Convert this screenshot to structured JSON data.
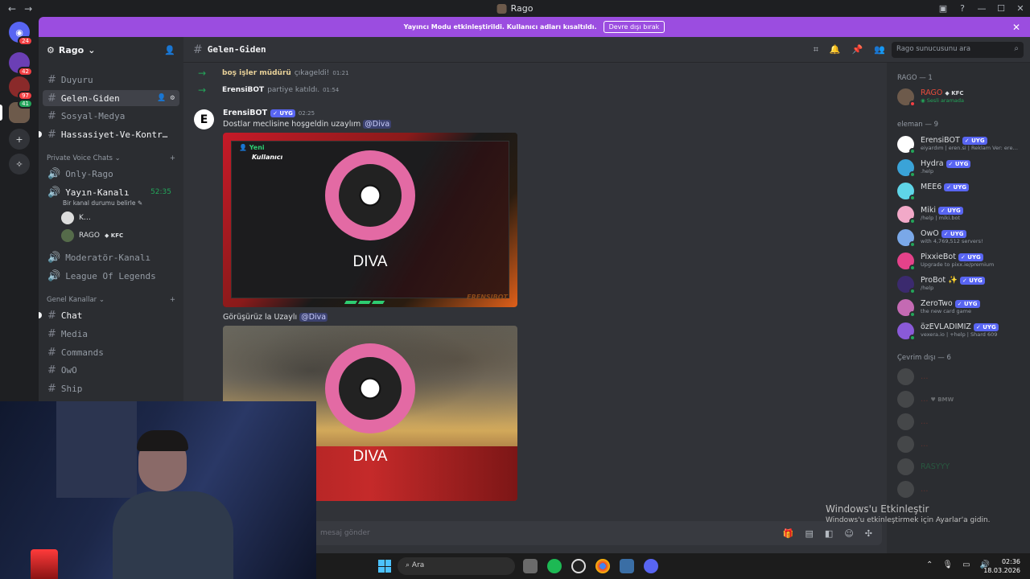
{
  "window": {
    "title": "Rago"
  },
  "banner": {
    "text": "Yayıncı Modu etkinleştirildi. Kullanıcı adları kısaltıldı.",
    "button": "Devre dışı bırak"
  },
  "rail": {
    "badges": [
      "24",
      "42",
      "97",
      "41"
    ]
  },
  "server": {
    "name": "Rago"
  },
  "channels": [
    {
      "name": "Duyuru"
    },
    {
      "name": "Gelen-Giden"
    },
    {
      "name": "Sosyal-Medya"
    },
    {
      "name": "Hassasiyet-Ve-Kontr…"
    }
  ],
  "private_voice": {
    "category": "Private Voice Chats",
    "channels": [
      {
        "name": "Only-Rago"
      },
      {
        "name": "Yayın-Kanalı",
        "timer": "52:35",
        "status": "Bir kanal durumu belirle"
      },
      {
        "name": "Moderatör-Kanalı"
      },
      {
        "name": "League Of Legends"
      }
    ],
    "voice_users": [
      {
        "name": "K…"
      },
      {
        "name": "RAGO",
        "tag": "KFC"
      }
    ]
  },
  "general": {
    "category": "Genel Kanallar",
    "channels": [
      {
        "name": "Chat"
      },
      {
        "name": "Media"
      },
      {
        "name": "Commands"
      },
      {
        "name": "OwO"
      },
      {
        "name": "Ship"
      }
    ]
  },
  "chat": {
    "channel": "Gelen-Giden",
    "search_placeholder": "Rago sunucusunu ara",
    "system": [
      {
        "user": "boş işler müdürü",
        "action": "çıkageldi!",
        "time": "01:21"
      },
      {
        "user": "ErensiBOT",
        "action": "partiye katıldı.",
        "time": "01:54"
      }
    ],
    "message": {
      "author": "ErensiBOT",
      "tag": "UYG",
      "time": "02:25",
      "line1": "Dostlar meclisine hoşgeldin uzaylım",
      "mention": "@Diva",
      "line2": "Görüşürüz la Uzaylı",
      "card1_new": "Yeni",
      "card1_user": "Kullanıcı",
      "card_label": "DIVA",
      "card_brand": "ERENSIBOT"
    },
    "composer_placeholder": "mesaj gönder"
  },
  "members": {
    "cat1": "RAGO — 1",
    "owner": {
      "name": "RAGO",
      "tag": "KFC",
      "sub": "Sesli aramada"
    },
    "cat2": "eleman — 9",
    "bots": [
      {
        "name": "ErensiBOT",
        "sub": "eiyardım | eren.si | Reklam Ver: ere…",
        "color": "#ffffff"
      },
      {
        "name": "Hydra",
        "sub": ".help",
        "color": "#3aa3d8"
      },
      {
        "name": "MEE6",
        "sub": "",
        "color": "#5fd5e8"
      },
      {
        "name": "Miki",
        "sub": "/help | miki.bot",
        "color": "#f2a9c8"
      },
      {
        "name": "OwO",
        "sub": "with 4,769,512 servers!",
        "color": "#7aa8e8"
      },
      {
        "name": "PixxieBot",
        "sub": "Upgrade to pixx.ie/premium",
        "color": "#e5428a"
      },
      {
        "name": "ProBot ✨",
        "sub": "/help",
        "color": "#3b2a6e"
      },
      {
        "name": "ZeroTwo",
        "sub": "the new card game",
        "color": "#c46ab3"
      },
      {
        "name": "özEVLADIMIZ",
        "sub": "vexera.io | +help | Shard 609",
        "color": "#8a5ad8"
      }
    ],
    "cat3": "Çevrim dışı — 6",
    "offline": [
      {
        "name": "…",
        "color": "#c0392b"
      },
      {
        "name": "…",
        "color": "#c0392b",
        "extra": "BMW"
      },
      {
        "name": "…",
        "color": "#c0392b"
      },
      {
        "name": "…",
        "color": "#c0392b"
      },
      {
        "name": "RASYYY",
        "color": "#23a55a"
      },
      {
        "name": "…",
        "color": "#c0392b"
      }
    ]
  },
  "windows_activation": {
    "title": "Windows'u Etkinleştir",
    "text": "Windows'u etkinleştirmek için Ayarlar'a gidin."
  },
  "taskbar": {
    "search": "Ara",
    "time": "02:36",
    "date": "18.03.2026"
  }
}
